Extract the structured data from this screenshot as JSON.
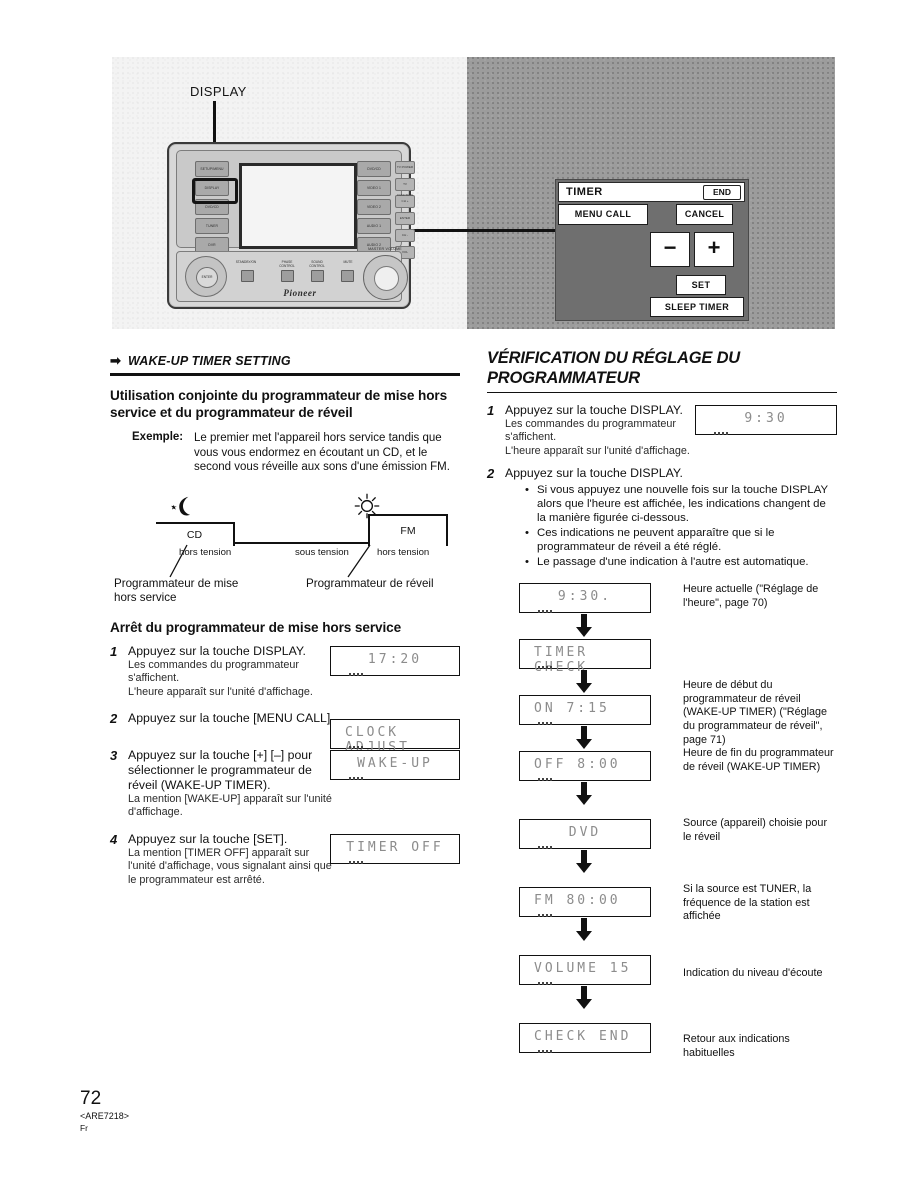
{
  "illustration": {
    "display_callout": "DISPLAY",
    "brand": "Pioneer",
    "master_volume_label": "MASTER VOLUME",
    "left_buttons": [
      "SETUP/MENU",
      "DISPLAY",
      "DVD/CD",
      "TUNER",
      "DVR"
    ],
    "right_buttons": [
      "DVD/CD",
      "VIDEO 1",
      "VIDEO 2",
      "AUDIO 1",
      "AUDIO 2"
    ],
    "far_buttons": [
      "TV POWER",
      "TV FUNCTION",
      "CH +",
      "ENTER",
      "CH -",
      "VOL"
    ],
    "panel_small_labels": [
      "STANDBY/ON",
      "PHASE CONTROL",
      "SOUND CONTROL",
      "MUTE"
    ],
    "dpad_center": "ENTER",
    "osd": {
      "title": "TIMER",
      "end": "END",
      "menu_call": "MENU CALL",
      "cancel": "CANCEL",
      "minus": "−",
      "plus": "+",
      "set": "SET",
      "sleep_timer": "SLEEP TIMER"
    }
  },
  "left_column": {
    "section_arrow": "➡",
    "section_title": "WAKE-UP TIMER SETTING",
    "heading": "Utilisation conjointe du programmateur de mise hors service et du programmateur de réveil",
    "example_label": "Exemple:",
    "example_text": "Le premier met l'appareil hors service tandis que vous vous endormez en écoutant un CD, et le second vous réveille aux sons d'une émission FM.",
    "timeline": {
      "block_cd": "CD",
      "block_fm": "FM",
      "label_off_1": "hors tension",
      "label_on": "sous tension",
      "label_off_2": "hors tension",
      "caption_left": "Programmateur de mise hors service",
      "caption_right": "Programmateur de réveil"
    },
    "subheading": "Arrêt du programmateur de mise hors service",
    "steps": [
      {
        "n": "1",
        "title": "Appuyez sur la touche DISPLAY.",
        "detail": "Les commandes du programmateur s'affichent.\nL'heure apparaît sur l'unité d'affichage.",
        "lcd": "17:20",
        "lcd_align": "center"
      },
      {
        "n": "2",
        "title": "Appuyez sur la touche [MENU CALL].",
        "detail": "",
        "lcd": "CLOCK ADJUST",
        "lcd_align": "left"
      },
      {
        "n": "3",
        "title": "Appuyez sur la touche [+] [–] pour sélectionner le programmateur de réveil (WAKE-UP TIMER).",
        "detail": "La mention [WAKE-UP] apparaît sur l'unité d'affichage.",
        "lcd": "WAKE-UP",
        "lcd_align": "center"
      },
      {
        "n": "4",
        "title": "Appuyez sur la touche [SET].",
        "detail": "La mention [TIMER OFF] apparaît sur l'unité d'affichage, vous signalant ainsi que le programmateur est arrêté.",
        "lcd": "TIMER OFF",
        "lcd_align": "center"
      }
    ]
  },
  "right_column": {
    "heading": "VÉRIFICATION DU RÉGLAGE DU PROGRAMMATEUR",
    "step1": {
      "n": "1",
      "title": "Appuyez sur la touche DISPLAY.",
      "detail": "Les commandes du programmateur s'affichent.\nL'heure apparaît sur l'unité d'affichage.",
      "lcd": "9:30"
    },
    "step2": {
      "n": "2",
      "title": "Appuyez sur la touche DISPLAY.",
      "bullets": [
        "Si vous appuyez une nouvelle fois sur la touche DISPLAY alors que l'heure est affichée, les indications changent de la manière figurée ci-dessous.",
        "Ces indications ne peuvent apparaître que si le programmateur de réveil a été réglé.",
        "Le passage d'une indication à l'autre est automatique."
      ]
    },
    "flow": [
      {
        "lcd": "9:30.",
        "align": "center",
        "note": "Heure actuelle (\"Réglage de l'heure\", page 70)"
      },
      {
        "lcd": "TIMER CHECK",
        "align": "left",
        "note": ""
      },
      {
        "lcd": "ON   7:15",
        "align": "left",
        "note": "Heure de début du programmateur de réveil (WAKE-UP TIMER) (\"Réglage du programmateur de réveil\", page 71)"
      },
      {
        "lcd": "OFF  8:00",
        "align": "left",
        "note": "Heure de fin du programmateur de réveil (WAKE-UP TIMER)"
      },
      {
        "lcd": "DVD",
        "align": "center",
        "note": "Source (appareil) choisie pour le réveil"
      },
      {
        "lcd": "FM    80:00",
        "align": "left",
        "note": "Si la source est TUNER, la fréquence de la station est affichée"
      },
      {
        "lcd": "VOLUME  15",
        "align": "left",
        "note": "Indication du niveau d'écoute"
      },
      {
        "lcd": "CHECK END",
        "align": "left",
        "note": "Retour aux indications habituelles"
      }
    ]
  },
  "footer": {
    "page_number": "72",
    "doc_code": "<ARE7218>",
    "lang": "Fr"
  }
}
